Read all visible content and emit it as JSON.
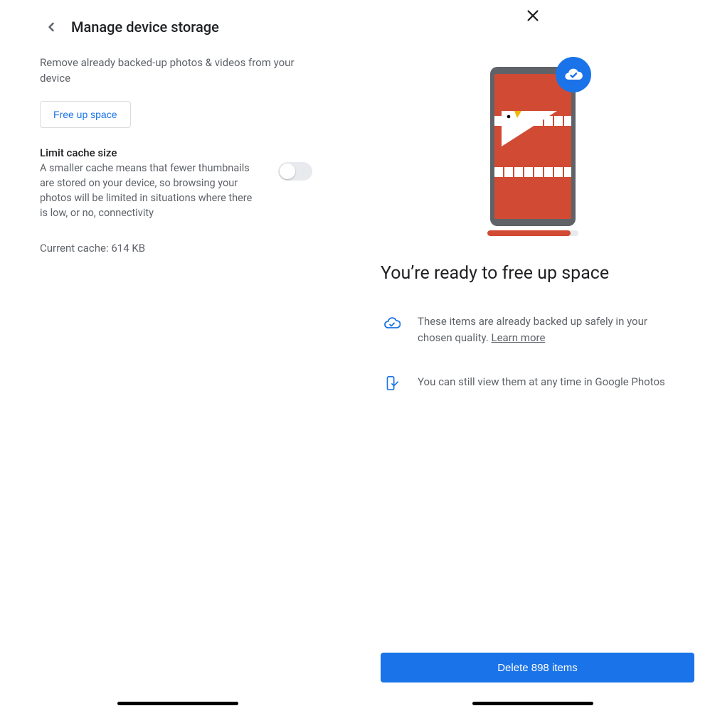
{
  "left": {
    "title": "Manage device storage",
    "description": "Remove already backed-up photos & videos from your device",
    "free_up_label": "Free up space",
    "cache_title": "Limit cache size",
    "cache_description": "A smaller cache means that fewer thumbnails are stored on your device, so browsing your photos will be limited in situations where there is low, or no, connectivity",
    "current_cache_label": "Current cache: 614 KB"
  },
  "right": {
    "title": "You’re ready to free up space",
    "info1_text": "These items are already backed up safely in your chosen quality. ",
    "info1_link": "Learn more",
    "info2_text": "You can still view them at any time in Google Photos",
    "delete_label": "Delete 898 items"
  }
}
